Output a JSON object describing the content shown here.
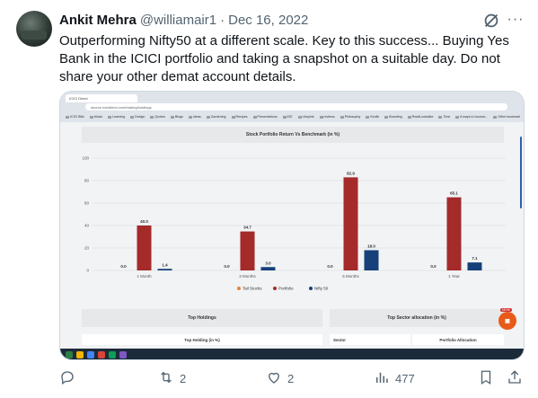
{
  "tweet": {
    "author_name": "Ankit Mehra",
    "handle": "@williamair1",
    "separator": "·",
    "date": "Dec 16, 2022",
    "text": "Outperforming Nifty50 at a different scale. Key to this success... Buying Yes Bank in the ICICI portfolio and taking a snapshot on a suitable day. Do not share your other demat account details.",
    "more_label": "···"
  },
  "screenshot": {
    "tab_title": "ICICI Direct",
    "url": "secure.icicidirect.com/trading/holdings",
    "bookmarks": [
      "ICICI Bills",
      "Music",
      "Learning",
      "Design",
      "Quotes",
      "Blogs",
      "Ideas",
      "Gardening",
      "Recipes",
      "Presentations",
      "IDE",
      "Libsylnk",
      "reviews",
      "Philosophy",
      "Kindle",
      "Branding",
      "ReadLookalike",
      "Time",
      "8 ways to bounce...",
      "Other bookmarks"
    ],
    "chart_card_title": "Stock Portfolio Return Vs Benchmark (in %)",
    "top_holdings": "Top Holdings",
    "top_sector": "Top Sector allocation (in %)",
    "top_holding_pct": "Top Holding (in %)",
    "sector_col": "Sector",
    "portfolio_alloc_col": "Portfolio Allocation",
    "new_badge": "NEW!"
  },
  "chart_data": {
    "type": "bar",
    "title": "Stock Portfolio Return Vs Benchmark (in %)",
    "categories": [
      "1 Month",
      "3 Months",
      "6 Months",
      "1 Year"
    ],
    "series": [
      {
        "name": "Tail Stocks",
        "color": "#e8823a",
        "values": [
          0.0,
          0.0,
          0.0,
          0.0
        ]
      },
      {
        "name": "Portfolio",
        "color": "#a52a2a",
        "values": [
          40.0,
          34.7,
          82.9,
          65.1
        ]
      },
      {
        "name": "Nifty 50",
        "color": "#16407a",
        "values": [
          1.4,
          3.0,
          18.0,
          7.1
        ]
      }
    ],
    "value_labels": [
      [
        "0.0",
        "40.0",
        "1.4"
      ],
      [
        "0.0",
        "34.7",
        "3.0"
      ],
      [
        "0.0",
        "82.9",
        "18.0"
      ],
      [
        "0.0",
        "65.1",
        "7.1"
      ]
    ],
    "yticks": [
      "0",
      "20",
      "40",
      "60",
      "80",
      "100"
    ],
    "ylim": [
      0,
      100
    ],
    "legend_position": "bottom",
    "grid": true
  },
  "actions": {
    "reply_count": "",
    "retweet_count": "2",
    "like_count": "2",
    "views_count": "477"
  },
  "colors": {
    "text_primary": "#0f1419",
    "text_secondary": "#536471",
    "border": "#cfd9de"
  },
  "icons": [
    "grok-icon",
    "more-icon",
    "reply-icon",
    "retweet-icon",
    "like-icon",
    "views-icon",
    "bookmark-icon",
    "share-icon"
  ]
}
